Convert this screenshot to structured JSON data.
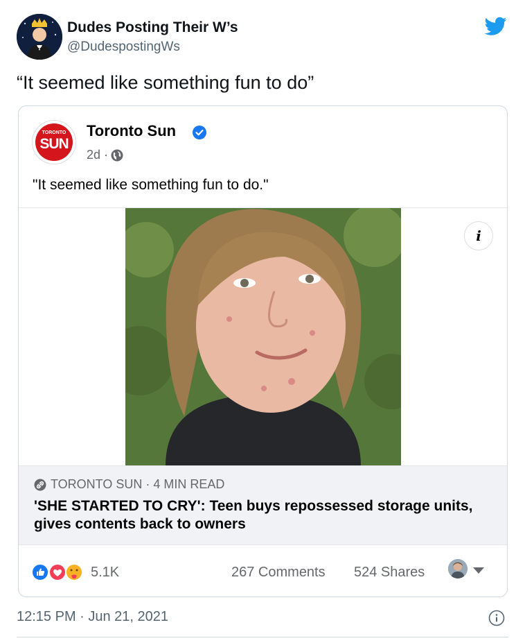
{
  "tweet": {
    "display_name": "Dudes Posting Their W’s",
    "handle": "@DudespostingWs",
    "text": "“It seemed like something fun to do”",
    "timestamp": "12:15 PM · Jun 21, 2021",
    "brand_color": "#1d9bf0"
  },
  "fb_post": {
    "logo": {
      "small_text": "TORONTO",
      "big_text": "SUN",
      "color": "#d4161c"
    },
    "page_name": "Toronto Sun",
    "age": "2d ·",
    "text": "\"It seemed like something fun to do.\"",
    "info_label": "i",
    "link": {
      "source": "TORONTO SUN · 4 MIN READ",
      "headline": "'SHE STARTED TO CRY': Teen buys repossessed storage units, gives contents back to owners"
    },
    "engagement": {
      "reactions": "5.1K",
      "comments": "267 Comments",
      "shares": "524 Shares"
    }
  }
}
